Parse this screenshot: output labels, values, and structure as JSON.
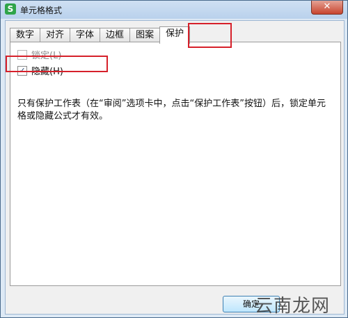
{
  "window": {
    "title": "单元格格式",
    "app_icon_letter": "S",
    "close_glyph": "✕"
  },
  "tabs": [
    {
      "label": "数字"
    },
    {
      "label": "对齐"
    },
    {
      "label": "字体"
    },
    {
      "label": "边框"
    },
    {
      "label": "图案"
    },
    {
      "label": "保护"
    }
  ],
  "active_tab": "保护",
  "protection": {
    "lock_label": "锁定(L)",
    "lock_checked": false,
    "hide_label": "隐藏(H)",
    "hide_checked": true,
    "check_glyph": "✓",
    "description": "只有保护工作表（在“审阅”选项卡中，点击“保护工作表”按钮）后，锁定单元格或隐藏公式才有效。"
  },
  "buttons": {
    "ok_label": "确定"
  },
  "watermark": "云南龙网",
  "colors": {
    "highlight": "#d6202a",
    "title_bar": "#b9d1ec"
  }
}
